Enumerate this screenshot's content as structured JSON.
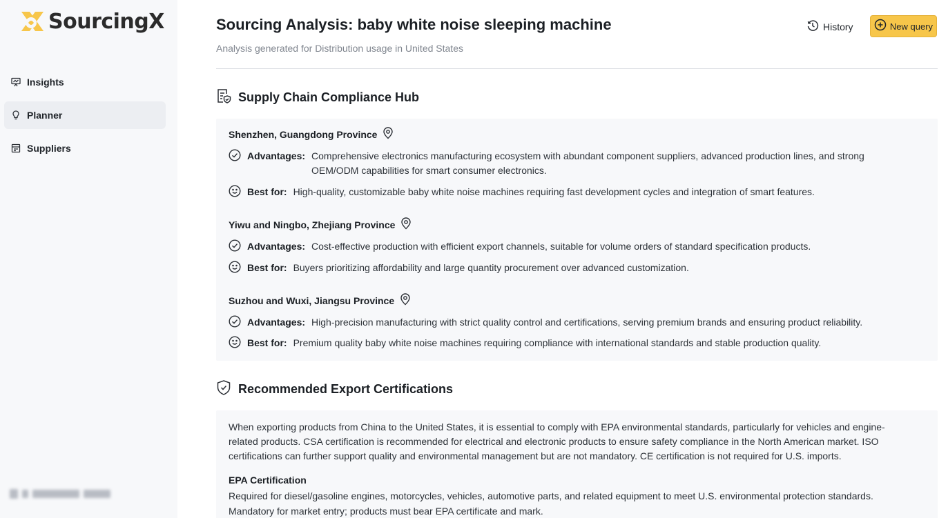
{
  "brand": {
    "name": "SourcingX",
    "accent": "#f7c64a"
  },
  "sidebar": {
    "items": [
      {
        "label": "Insights",
        "icon": "presentation-chart-icon"
      },
      {
        "label": "Planner",
        "icon": "lightbulb-icon",
        "active": true
      },
      {
        "label": "Suppliers",
        "icon": "store-icon"
      }
    ]
  },
  "header": {
    "title": "Sourcing Analysis: baby white noise sleeping machine",
    "subtitle": "Analysis generated for Distribution usage in United States",
    "history_label": "History",
    "new_query_label": "New query"
  },
  "hub": {
    "title": "Supply Chain Compliance Hub",
    "regions": [
      {
        "name": "Shenzhen, Guangdong Province",
        "advantages_label": "Advantages:",
        "advantages": "Comprehensive electronics manufacturing ecosystem with abundant component suppliers, advanced production lines, and strong OEM/ODM capabilities for smart consumer electronics.",
        "best_for_label": "Best for:",
        "best_for": "High-quality, customizable baby white noise machines requiring fast development cycles and integration of smart features."
      },
      {
        "name": "Yiwu and Ningbo, Zhejiang Province",
        "advantages_label": "Advantages:",
        "advantages": "Cost-effective production with efficient export channels, suitable for volume orders of standard specification products.",
        "best_for_label": "Best for:",
        "best_for": "Buyers prioritizing affordability and large quantity procurement over advanced customization."
      },
      {
        "name": "Suzhou and Wuxi, Jiangsu Province",
        "advantages_label": "Advantages:",
        "advantages": "High-precision manufacturing with strict quality control and certifications, serving premium brands and ensuring product reliability.",
        "best_for_label": "Best for:",
        "best_for": "Premium quality baby white noise machines requiring compliance with international standards and stable production quality."
      }
    ]
  },
  "certs": {
    "title": "Recommended Export Certifications",
    "intro": "When exporting products from China to the United States, it is essential to comply with EPA environmental standards, particularly for vehicles and engine-related products. CSA certification is recommended for electrical and electronic products to ensure safety compliance in the North American market. ISO certifications can further support quality and environmental management but are not mandatory. CE certification is not required for U.S. imports.",
    "items": [
      {
        "name": "EPA Certification",
        "text": "Required for diesel/gasoline engines, motorcycles, vehicles, automotive parts, and related equipment to meet U.S. environmental protection standards. Mandatory for market entry; products must bear EPA certificate and mark."
      }
    ]
  }
}
